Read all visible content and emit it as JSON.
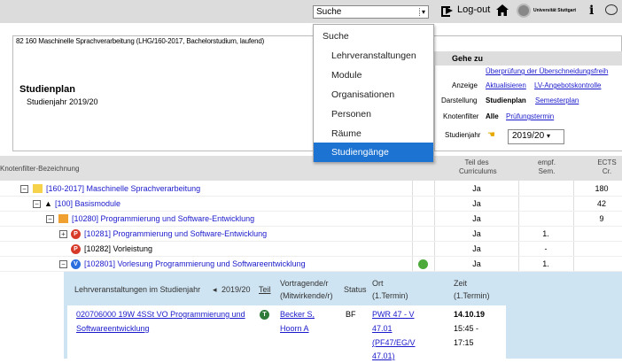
{
  "topbar": {
    "search_value": "Suche",
    "logout_label": "Log-out",
    "university": "Universität Stuttgart"
  },
  "dropdown": {
    "items": [
      "Suche",
      "Lehrveranstaltungen",
      "Module",
      "Organisationen",
      "Personen",
      "Räume",
      "Studiengänge"
    ],
    "selected": "Studiengänge"
  },
  "header": {
    "breadcrumb": "82 160 Maschinelle Sprachverarbeitung (LHG/160-2017, Bachelorstudium, laufend)",
    "title": "Studienplan",
    "subtitle": "Studienjahr 2019/20"
  },
  "goto": {
    "label": "Gehe zu",
    "link1": "Überprüfung der Überschneidungsfreih",
    "anzeige_label": "Anzeige",
    "aktualisieren": "Aktualisieren",
    "lv_check": "LV-Angebotskontrolle",
    "darstellung_label": "Darstellung",
    "studienplan": "Studienplan",
    "semesterplan": "Semesterplan",
    "knotenfilter_label": "Knotenfilter",
    "alle": "Alle",
    "pruefungstermin": "Prüfungstermin",
    "studienjahr_label": "Studienjahr",
    "year": "2019/20"
  },
  "table": {
    "headers": {
      "name": "Knotenfilter-Bezeichnung",
      "curr": "Teil des Curriculums",
      "sem": "empf. Sem.",
      "ects": "ECTS Cr."
    },
    "rows": [
      {
        "label": "[160-2017] Maschinelle Sprachverarbeitung",
        "curr": "Ja",
        "sem": "",
        "ects": "180"
      },
      {
        "label": "[100] Basismodule",
        "curr": "Ja",
        "sem": "",
        "ects": "42"
      },
      {
        "label": "[10280] Programmierung und Software-Entwicklung",
        "curr": "Ja",
        "sem": "",
        "ects": "9"
      },
      {
        "label": "[10281] Programmierung und Software-Entwicklung",
        "curr": "Ja",
        "sem": "1.",
        "ects": ""
      },
      {
        "label": "[10282] Vorleistung",
        "curr": "Ja",
        "sem": "-",
        "ects": ""
      },
      {
        "label": "[102801] Vorlesung Programmierung und Softwareentwicklung",
        "curr": "Ja",
        "sem": "1.",
        "ects": ""
      }
    ]
  },
  "subtable": {
    "h_lv": "Lehrveranstaltungen im Studienjahr",
    "h_year": "2019/20",
    "h_teil": "Teil",
    "h_vortr": "Vortragende/r",
    "h_mitw": "(Mitwirkende/r)",
    "h_status": "Status",
    "h_ort": "Ort",
    "h_ort2": "(1.Termin)",
    "h_zeit": "Zeit",
    "h_zeit2": "(1.Termin)",
    "course_line1": "020706000 19W 4SSt VO Programmierung und",
    "course_line2": "Softwareentwicklung",
    "lecturer1": "Becker S,",
    "lecturer2": "Hoorn A",
    "status": "BF",
    "ort1": "PWR 47 - V",
    "ort2": "47.01",
    "ort3": "(PF47/EG/V",
    "ort4": "47.01)",
    "zeit1": "14.10.19",
    "zeit2": "15:45 -",
    "zeit3": "17:15"
  },
  "colors": {
    "accent": "#1c73d1",
    "link": "#1a1acc",
    "subtable_bg": "#cfe4f2"
  }
}
